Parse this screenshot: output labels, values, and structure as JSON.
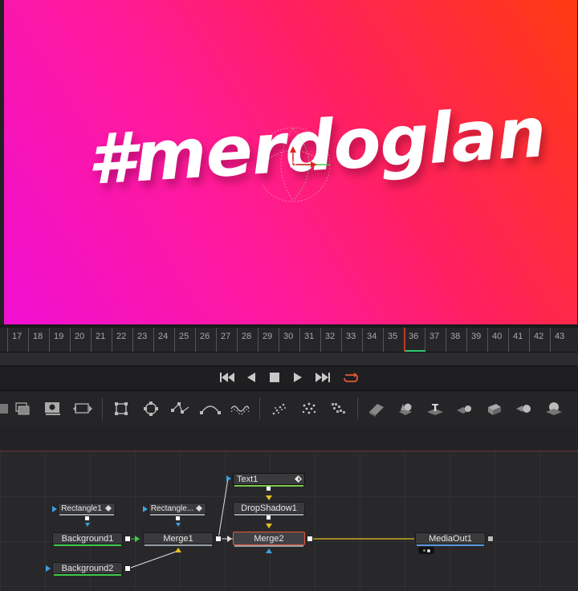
{
  "viewer": {
    "overlay_text": "#merdoglan",
    "gradient_colors": [
      "#f00fd2",
      "#ff1a9a",
      "#ff2060",
      "#ff3a10"
    ]
  },
  "timeline": {
    "frames": [
      "17",
      "18",
      "19",
      "20",
      "21",
      "22",
      "23",
      "24",
      "25",
      "26",
      "27",
      "28",
      "29",
      "30",
      "31",
      "32",
      "33",
      "34",
      "35",
      "36",
      "37",
      "38",
      "39",
      "40",
      "41",
      "42",
      "43"
    ],
    "current_frame": "36",
    "playhead_color": "#c0392b"
  },
  "transport": {
    "buttons": [
      {
        "name": "go-to-start-button",
        "glyph": "⏮"
      },
      {
        "name": "play-reverse-button",
        "glyph": "◀"
      },
      {
        "name": "stop-button",
        "glyph": "■"
      },
      {
        "name": "play-forward-button",
        "glyph": "▶"
      },
      {
        "name": "go-to-end-button",
        "glyph": "⏭"
      },
      {
        "name": "loop-button",
        "glyph": "↻"
      }
    ],
    "loop_color": "#e05a3a"
  },
  "toolbar": {
    "tools": [
      "merge-tool-icon",
      "background-tool-icon",
      "image-tool-icon",
      "transform-tool-icon",
      "rectangle-mask-icon",
      "ellipse-mask-icon",
      "polygon-mask-icon",
      "bspline-mask-icon",
      "paint-tool-icon",
      "particle-emitter-icon",
      "particle-render-icon",
      "pixel-grid-icon",
      "image-plane-3d-icon",
      "shape-3d-icon",
      "text-3d-icon",
      "merge-3d-icon",
      "camera-3d-icon",
      "light-3d-icon",
      "renderer-3d-icon"
    ]
  },
  "nodes": {
    "text1": "Text1",
    "dropshadow1": "DropShadow1",
    "rectangle1": "Rectangle1",
    "rectangle2": "Rectangle...",
    "background1": "Background1",
    "merge1": "Merge1",
    "merge2": "Merge2",
    "mediaout1": "MediaOut1",
    "background2": "Background2"
  },
  "colors": {
    "background_node_underline": "#3ecb4a",
    "merge_node_underline": "#9aa0a8",
    "text_node_underline": "#7fc84a",
    "mediaout_underline": "#5b9ae0",
    "selected_border": "#e05a3a",
    "wire_yellow": "#e8c020",
    "wire_green": "#3ecb4a",
    "wire_white": "#e0e0e0",
    "input_blue": "#3da0e0"
  }
}
